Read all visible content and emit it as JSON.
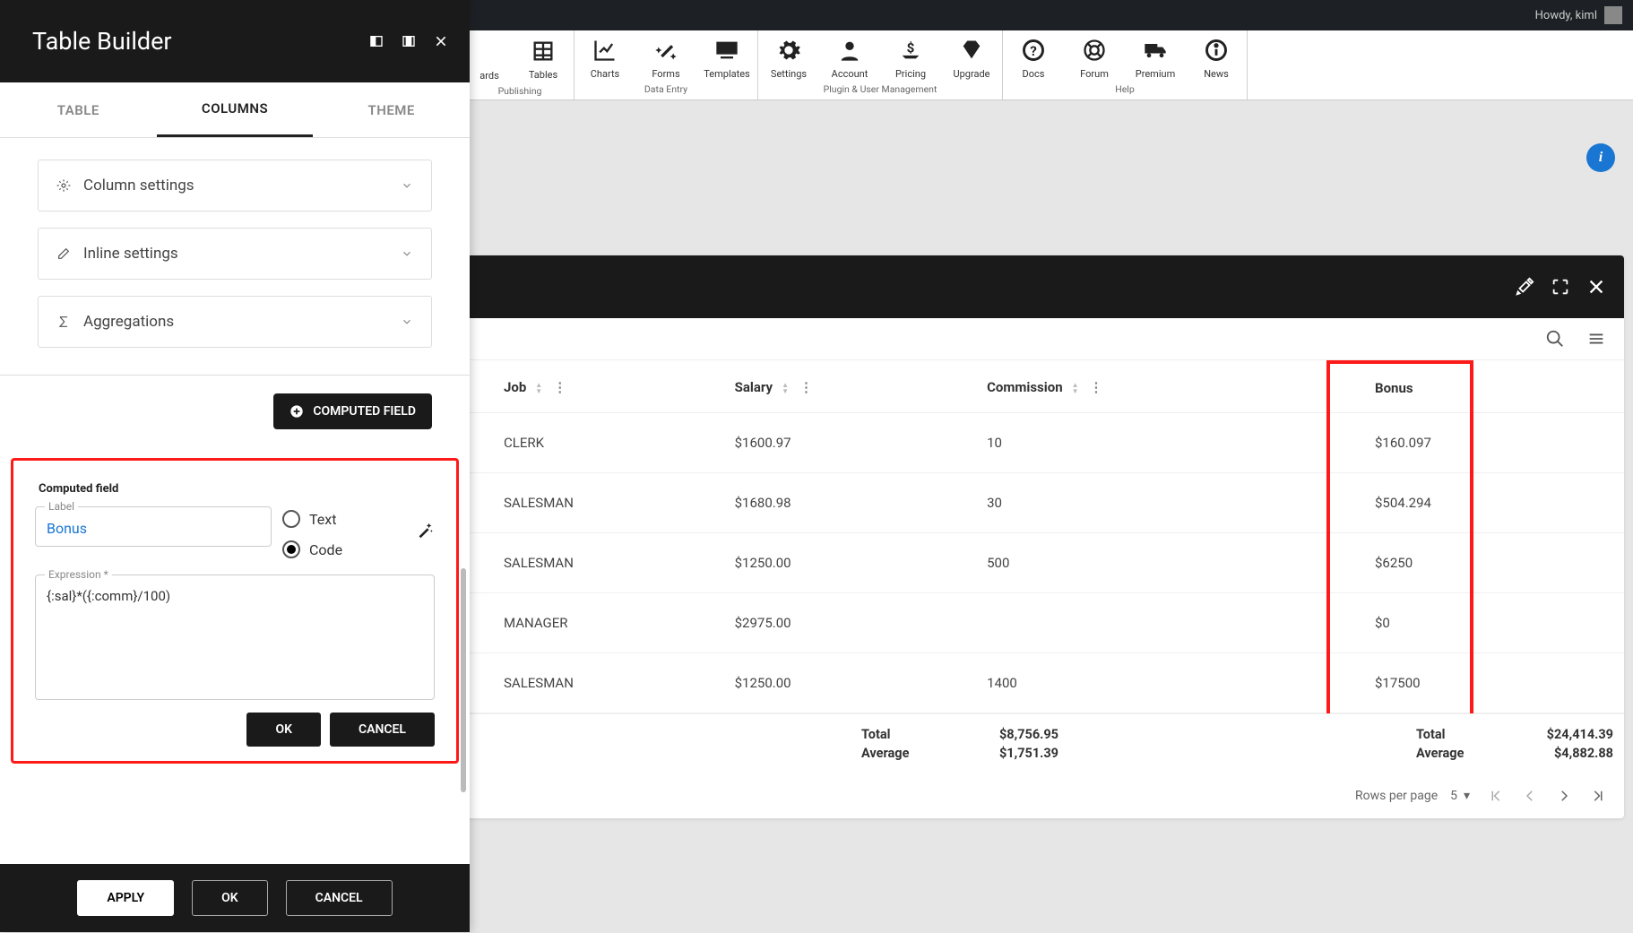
{
  "topbar": {
    "greeting": "Howdy, kiml"
  },
  "toolbar": {
    "items": [
      {
        "label": "ards"
      },
      {
        "label": "Tables"
      },
      {
        "label": "Charts"
      },
      {
        "label": "Forms"
      },
      {
        "label": "Templates"
      },
      {
        "label": "Settings"
      },
      {
        "label": "Account"
      },
      {
        "label": "Pricing"
      },
      {
        "label": "Upgrade"
      },
      {
        "label": "Docs"
      },
      {
        "label": "Forum"
      },
      {
        "label": "Premium"
      },
      {
        "label": "News"
      }
    ],
    "groups": [
      "Publishing",
      "Data Entry",
      "Plugin & User Management",
      "Help"
    ]
  },
  "sidebar": {
    "title": "Table Builder",
    "tabs": {
      "table": "TABLE",
      "columns": "COLUMNS",
      "theme": "THEME"
    },
    "accordion": {
      "column_settings": "Column settings",
      "inline_settings": "Inline settings",
      "aggregations": "Aggregations"
    },
    "computed_btn": "COMPUTED FIELD",
    "computed_field": {
      "legend": "Computed field",
      "label_caption": "Label",
      "label_value": "Bonus",
      "radio_text": "Text",
      "radio_code": "Code",
      "expr_caption": "Expression *",
      "expr_value": "{:sal}*({:comm}/100)",
      "ok": "OK",
      "cancel": "CANCEL"
    },
    "footer": {
      "apply": "APPLY",
      "ok": "OK",
      "cancel": "CANCEL"
    }
  },
  "table": {
    "columns": {
      "job": "Job",
      "salary": "Salary",
      "commission": "Commission",
      "bonus": "Bonus"
    },
    "rows": [
      {
        "job": "CLERK",
        "salary": "$1600.97",
        "commission": "10",
        "bonus": "$160.097"
      },
      {
        "job": "SALESMAN",
        "salary": "$1680.98",
        "commission": "30",
        "bonus": "$504.294"
      },
      {
        "job": "SALESMAN",
        "salary": "$1250.00",
        "commission": "500",
        "bonus": "$6250"
      },
      {
        "job": "MANAGER",
        "salary": "$2975.00",
        "commission": "",
        "bonus": "$0"
      },
      {
        "job": "SALESMAN",
        "salary": "$1250.00",
        "commission": "1400",
        "bonus": "$17500"
      }
    ],
    "footer": {
      "salary": {
        "total_label": "Total",
        "total_val": "$8,756.95",
        "avg_label": "Average",
        "avg_val": "$1,751.39"
      },
      "bonus": {
        "total_label": "Total",
        "total_val": "$24,414.39",
        "avg_label": "Average",
        "avg_val": "$4,882.88"
      }
    },
    "pagination": {
      "rows_per_page": "Rows per page",
      "value": "5"
    }
  }
}
